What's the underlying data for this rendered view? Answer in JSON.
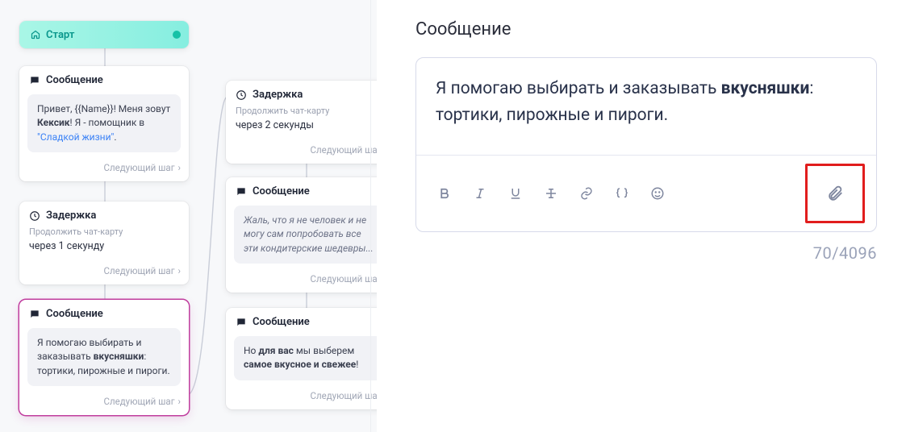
{
  "panel": {
    "title": "Сообщение",
    "message_pre": "Я помогаю выбирать и заказывать ",
    "message_bold": "вкусняшки",
    "message_post": ": тортики, пирожные и пироги.",
    "char_count": "70/4096"
  },
  "icons": {
    "bold": "bold-icon",
    "italic": "italic-icon",
    "underline": "underline-icon",
    "strike": "strikethrough-icon",
    "link": "link-icon",
    "braces": "braces-icon",
    "emoji": "emoji-icon",
    "attach": "attach-icon"
  },
  "flow": {
    "start": {
      "label": "Старт"
    },
    "next_step": "Следующий шаг",
    "msg_heading": "Сообщение",
    "delay_heading": "Задержка",
    "delay_sub": "Продолжить чат-карту",
    "msg1_pre": "Привет, {{Name}}! Меня зовут ",
    "msg1_bold": "Кексик",
    "msg1_mid": "! Я - помощник в ",
    "msg1_link": "\"Сладкой жизни\"",
    "msg1_post": ".",
    "del1_body": "через 1 секунду",
    "msg2_pre": "Я помогаю выбирать и заказывать ",
    "msg2_bold": "вкусняшки",
    "msg2_post": ": тортики, пирожные и пироги.",
    "del2_body": "через 2 секунды",
    "msg3": "Жаль, что я не человек и не могу сам попробовать все эти кондитерские шедевры...",
    "msg4_pre": "Но ",
    "msg4_b1": "для вас",
    "msg4_mid": " мы выберем ",
    "msg4_b2": "самое вкусное и свежее",
    "msg4_post": "!"
  }
}
